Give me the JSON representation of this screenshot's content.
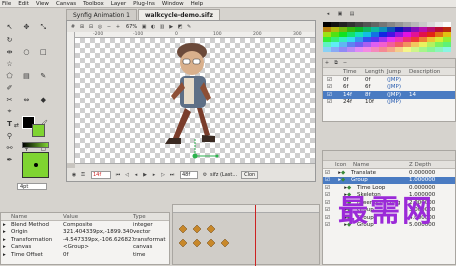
{
  "menu": [
    "File",
    "Edit",
    "View",
    "Canvas",
    "Toolbox",
    "Layer",
    "Plug-Ins",
    "Window",
    "Help"
  ],
  "tabs": [
    {
      "label": "Synfig Animation 1",
      "active": false
    },
    {
      "label": "walkcycle-demo.sifz",
      "active": true
    }
  ],
  "canvas_toolbar_zoom": "67%",
  "ruler_marks": [
    "-200",
    "-100",
    "0",
    "100",
    "200",
    "300"
  ],
  "frame_field": "14f",
  "time_end": "48f",
  "render_label": "sifz (Last...",
  "clone_label": "Clon",
  "brush_size": "4pt",
  "library_panel": {
    "columns": [
      "Time",
      "Length",
      "Jump",
      "Description"
    ],
    "rows": [
      {
        "time": "0f",
        "length": "0f",
        "jump": "(JMP)",
        "desc": "",
        "selected": false
      },
      {
        "time": "6f",
        "length": "6f",
        "jump": "(JMP)",
        "desc": "",
        "selected": false
      },
      {
        "time": "14f",
        "length": "8f",
        "jump": "(JMP)",
        "desc": "14",
        "selected": true
      },
      {
        "time": "24f",
        "length": "10f",
        "jump": "(JMP)",
        "desc": "",
        "selected": false
      }
    ]
  },
  "layers_panel": {
    "columns": [
      "Icon",
      "Name",
      "Z Depth"
    ],
    "rows": [
      {
        "name": "Translate",
        "z": "0.000000",
        "indent": 0,
        "selected": false
      },
      {
        "name": "Group",
        "z": "1.000000",
        "indent": 0,
        "selected": true
      },
      {
        "name": "Time Loop",
        "z": "0.000000",
        "indent": 1,
        "selected": false
      },
      {
        "name": "Skeleton",
        "z": "1.000000",
        "indent": 1,
        "selected": false
      },
      {
        "name": "lower arm-l.png",
        "z": "2.000000",
        "indent": 1,
        "selected": false
      },
      {
        "name": "Group",
        "z": "3.000000",
        "indent": 1,
        "selected": false
      },
      {
        "name": "Group",
        "z": "4.000000",
        "indent": 1,
        "selected": false
      },
      {
        "name": "Group",
        "z": "5.000000",
        "indent": 1,
        "selected": false
      }
    ]
  },
  "params_panel": {
    "columns": [
      "Name",
      "Value",
      "Type"
    ],
    "rows": [
      {
        "name": "Blend Method",
        "value": "Composite",
        "type": "integer"
      },
      {
        "name": "Origin",
        "value": "321.404339px,-1899.340",
        "type": "vector"
      },
      {
        "name": "Transformation",
        "value": "-4.547339px,-106.626827",
        "type": "transformat"
      },
      {
        "name": "Canvas",
        "value": "<Group>",
        "type": "canvas"
      },
      {
        "name": "Time Offset",
        "value": "0f",
        "type": "time"
      }
    ]
  },
  "watermark": "最需网",
  "colors": {
    "outline": "#000000",
    "fill": "#7fd431",
    "accent": "#4a7bc2",
    "watermark": "#9b2ad8"
  }
}
